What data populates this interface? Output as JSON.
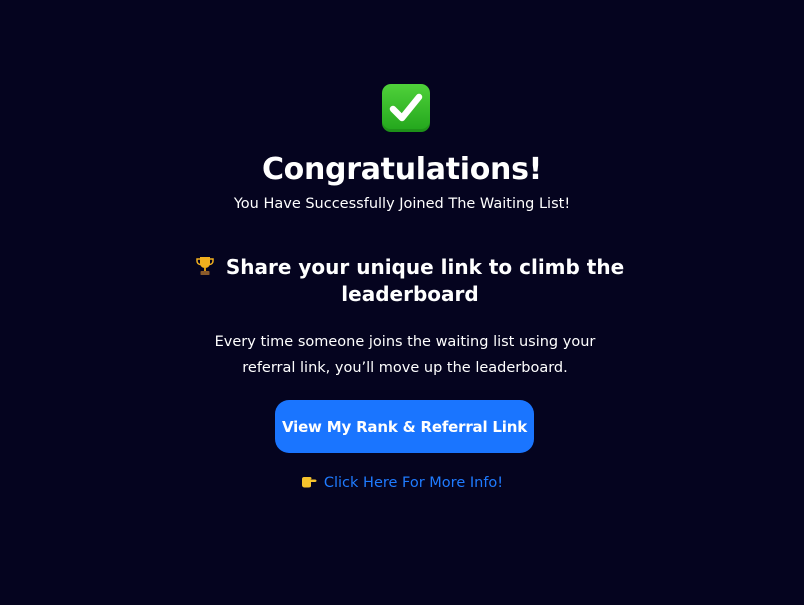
{
  "header": {
    "icon": "check-mark-button-icon",
    "title": "Congratulations!",
    "subtitle": "You Have Successfully Joined The Waiting List!"
  },
  "share": {
    "icon": "trophy-icon",
    "heading": "Share your unique link to climb the leaderboard",
    "description": "Every time someone joins the waiting list using your referral link, you’ll move up the leaderboard."
  },
  "actions": {
    "rank_button_label": "View My Rank & Referral Link",
    "info_icon": "pointing-hand-icon",
    "info_link_label": "Click Here For More Info!"
  },
  "colors": {
    "background": "#05041f",
    "accent": "#1a75ff",
    "link": "#1f7bff",
    "success": "#2fb82a"
  }
}
